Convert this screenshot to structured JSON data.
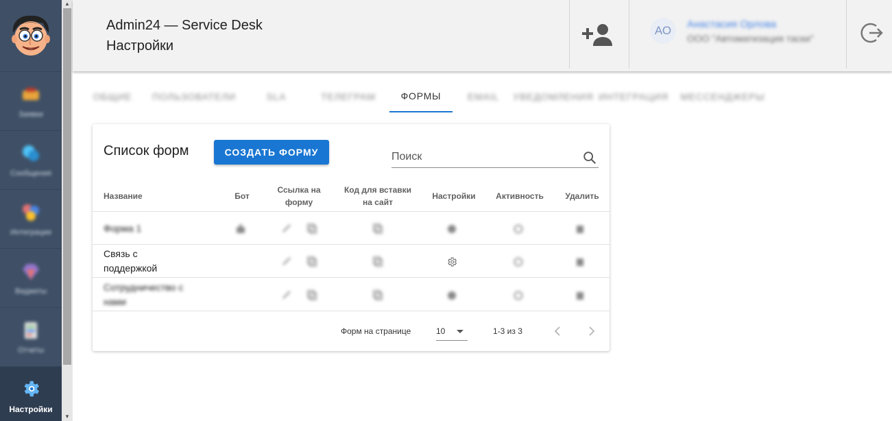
{
  "sidebar": {
    "items": [
      {
        "label": "Заявки",
        "icon": "tickets-icon",
        "color": "#e8a43a"
      },
      {
        "label": "Сообщения",
        "icon": "messages-icon",
        "color": "#4fc3f7"
      },
      {
        "label": "Интеграции",
        "icon": "integrations-icon",
        "color": "#e57373"
      },
      {
        "label": "Виджеты",
        "icon": "widgets-icon",
        "color": "#9575cd"
      },
      {
        "label": "Отчеты",
        "icon": "reports-icon",
        "color": "#81c784"
      }
    ],
    "active": {
      "label": "Настройки",
      "icon": "gear-icon"
    }
  },
  "header": {
    "app_title": "Admin24 — Service Desk",
    "page_title": "Настройки",
    "user": {
      "initials": "АО",
      "name": "Анастасия Орлова",
      "org": "ООО \"Автоматизация таски\""
    }
  },
  "tabs": [
    {
      "label": "Общие",
      "active": false
    },
    {
      "label": "Пользователи",
      "active": false
    },
    {
      "label": "SLA",
      "active": false
    },
    {
      "label": "Телеграм",
      "active": false
    },
    {
      "label": "Формы",
      "active": true
    },
    {
      "label": "Email",
      "active": false
    },
    {
      "label": "Уведомления",
      "active": false
    },
    {
      "label": "Интеграция",
      "active": false
    },
    {
      "label": "Мессенджеры",
      "active": false
    }
  ],
  "card": {
    "title": "Список форм",
    "create_label": "СОЗДАТЬ ФОРМУ",
    "search_placeholder": "Поиск",
    "columns": {
      "name": "Название",
      "bot": "Бот",
      "link": "Ссылка на форму",
      "code": "Код для вставки на сайт",
      "settings": "Настройки",
      "active": "Активность",
      "delete": "Удалить"
    },
    "rows": [
      {
        "name": "Форма 1",
        "blurred": true,
        "has_bot": true
      },
      {
        "name": "Связь с поддержкой",
        "blurred": false,
        "has_bot": false
      },
      {
        "name": "Сотрудничество с нами",
        "blurred": true,
        "has_bot": false
      }
    ],
    "footer": {
      "per_page_label": "Форм на странице",
      "per_page_value": "10",
      "range": "1-3 из 3"
    }
  }
}
